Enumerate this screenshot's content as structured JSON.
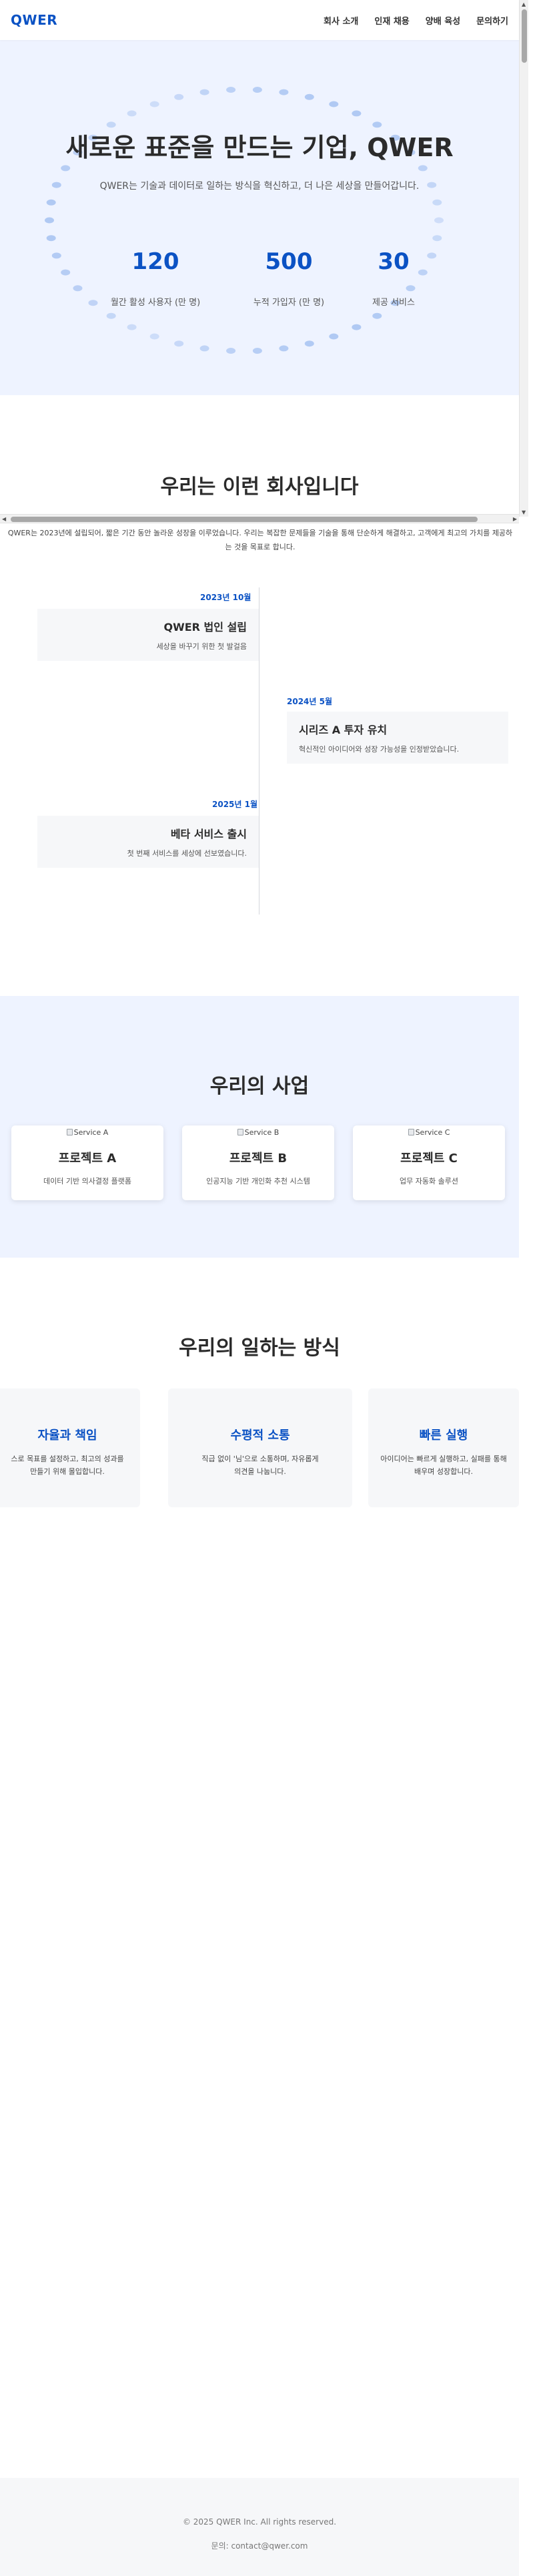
{
  "header": {
    "logo": "QWER",
    "nav": [
      "회사 소개",
      "인재 채용",
      "양배 육성",
      "문의하기"
    ]
  },
  "hero": {
    "title": "새로운 표준을 만드는 기업, QWER",
    "subtitle": "QWER는 기술과 데이터로 일하는 방식을 혁신하고, 더 나은 세상을 만들어갑니다.",
    "stats": [
      {
        "value": "120",
        "label": "월간 활성 사용자 (만 명)"
      },
      {
        "value": "500",
        "label": "누적 가입자 (만 명)"
      },
      {
        "value": "30",
        "label": "제공 서비스"
      }
    ]
  },
  "about": {
    "title": "우리는 이런 회사입니다",
    "text": "QWER는 2023년에 설립되어, 짧은 기간 동안 놀라운 성장을 이루었습니다. 우리는 복잡한 문제들을 기술을 통해 단순하게 해결하고, 고객에게 최고의 가치를 제공하는 것을 목표로 합니다."
  },
  "timeline": [
    {
      "date": "2023년 10월",
      "title": "QWER 법인 설립",
      "desc": "세상을 바꾸기 위한 첫 발걸음"
    },
    {
      "date": "2024년 5월",
      "title": "시리즈 A 투자 유치",
      "desc": "혁신적인 아이디어와 성장 가능성을 인정받았습니다."
    },
    {
      "date": "2025년 1월",
      "title": "베타 서비스 출시",
      "desc": "첫 번째 서비스를 세상에 선보였습니다."
    }
  ],
  "business": {
    "title": "우리의 사업",
    "cards": [
      {
        "img_alt": "Service A",
        "title": "프로젝트 A",
        "desc": "데이터 기반 의사결정 플랫폼"
      },
      {
        "img_alt": "Service B",
        "title": "프로젝트 B",
        "desc": "인공지능 기반 개인화 추천 시스템"
      },
      {
        "img_alt": "Service C",
        "title": "프로젝트 C",
        "desc": "업무 자동화 솔루션"
      }
    ]
  },
  "way": {
    "title": "우리의 일하는 방식",
    "cards": [
      {
        "title": "자율과 책임",
        "desc": "스로 목표를 설정하고, 최고의 성과를 만들기 위해 몰입합니다."
      },
      {
        "title": "수평적 소통",
        "desc": "직급 없이 '님'으로 소통하며, 자유롭게 의견을 나눕니다."
      },
      {
        "title": "빠른 실행",
        "desc": "아이디어는 빠르게 실행하고, 실패를 통해 배우며 성장합니다."
      }
    ]
  },
  "footer": {
    "copyright": "© 2025 QWER Inc. All rights reserved.",
    "contact": "문의: contact@qwer.com"
  },
  "colors": {
    "accent": "#0b52c4",
    "hero_bg": "#eef3ff",
    "card_bg": "#f6f7f9"
  }
}
